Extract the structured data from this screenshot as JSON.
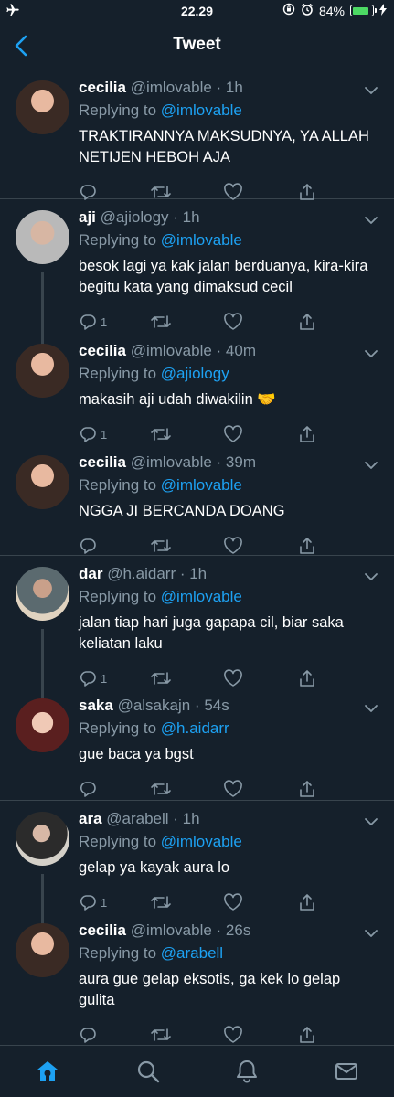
{
  "status_bar": {
    "time": "22.29",
    "battery": "84%",
    "battery_level": 0.84
  },
  "nav": {
    "title": "Tweet"
  },
  "reply_prefix": "Replying to",
  "tweets": [
    {
      "name": "cecilia",
      "handle": "@imlovable",
      "time": "1h",
      "replying_to": "@imlovable",
      "text": "TRAKTIRANNYA MAKSUDNYA, YA ALLAH NETIJEN HEBOH AJA",
      "reply_count": ""
    },
    {
      "name": "aji",
      "handle": "@ajiology",
      "time": "1h",
      "replying_to": "@imlovable",
      "text": "besok lagi ya kak jalan berduanya, kira-kira begitu kata yang dimaksud cecil",
      "reply_count": "1"
    },
    {
      "name": "cecilia",
      "handle": "@imlovable",
      "time": "40m",
      "replying_to": "@ajiology",
      "text": "makasih aji udah diwakilin 🤝",
      "reply_count": "1"
    },
    {
      "name": "cecilia",
      "handle": "@imlovable",
      "time": "39m",
      "replying_to": "@imlovable",
      "text": "NGGA JI BERCANDA DOANG",
      "reply_count": ""
    },
    {
      "name": "dar",
      "handle": "@h.aidarr",
      "time": "1h",
      "replying_to": "@imlovable",
      "text": "jalan tiap hari juga gapapa cil, biar saka keliatan laku",
      "reply_count": "1"
    },
    {
      "name": "saka",
      "handle": "@alsakajn",
      "time": "54s",
      "replying_to": "@h.aidarr",
      "text": "gue baca ya bgst",
      "reply_count": ""
    },
    {
      "name": "ara",
      "handle": "@arabell",
      "time": "1h",
      "replying_to": "@imlovable",
      "text": "gelap ya kayak aura lo",
      "reply_count": "1"
    },
    {
      "name": "cecilia",
      "handle": "@imlovable",
      "time": "26s",
      "replying_to": "@arabell",
      "text": "aura gue gelap eksotis, ga kek lo gelap gulita",
      "reply_count": ""
    }
  ],
  "tabs": [
    "home-icon",
    "search-icon",
    "bell-icon",
    "mail-icon"
  ],
  "colors": {
    "background": "#15202b",
    "accent": "#1da1f2",
    "muted": "#8899a6",
    "divider": "#38444d"
  }
}
